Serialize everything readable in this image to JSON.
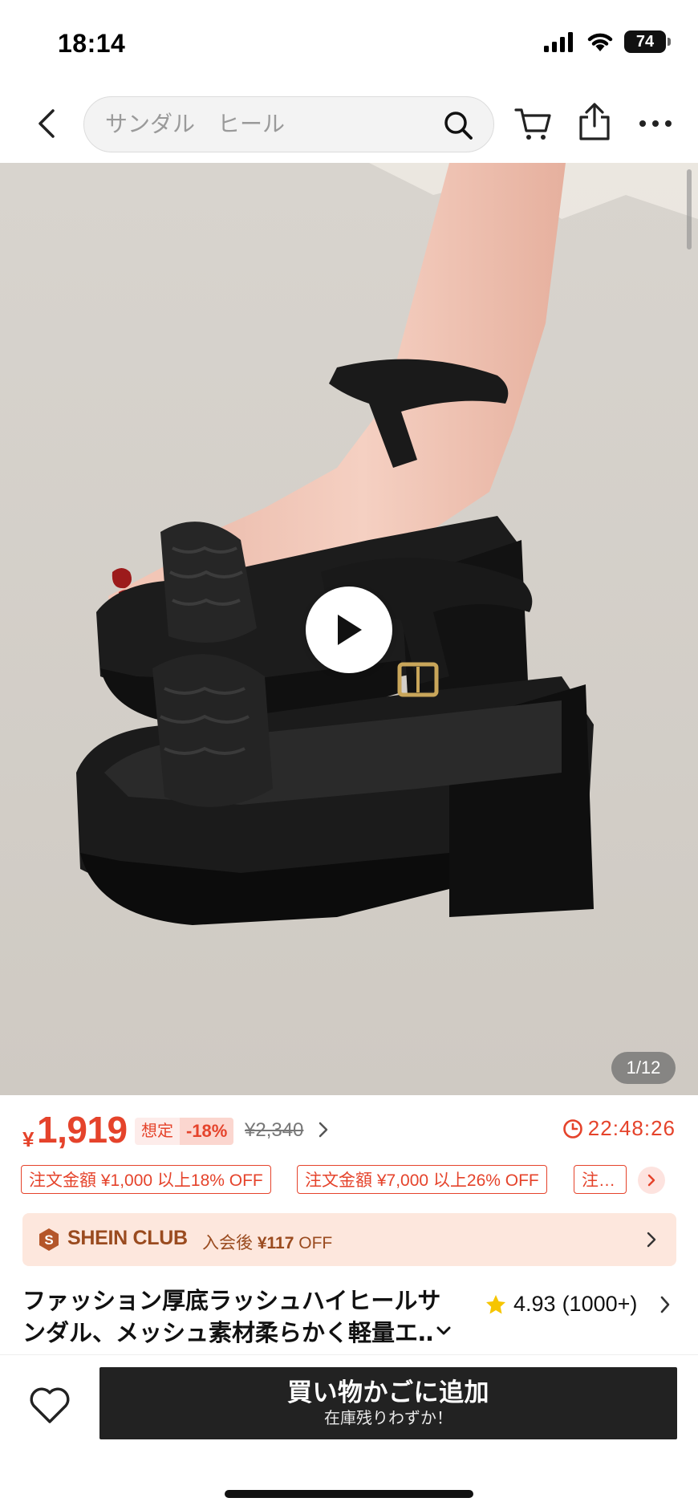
{
  "status_bar": {
    "time": "18:14",
    "battery": "74"
  },
  "header": {
    "search_placeholder": "サンダル　ヒール"
  },
  "gallery": {
    "counter": "1/12"
  },
  "price": {
    "currency": "¥",
    "current": "1,919",
    "estimated_label": "想定",
    "discount": "-18%",
    "original": "¥2,340",
    "countdown": "22:48:26"
  },
  "coupons": [
    {
      "label": "注文金額 ¥1,000 以上18% OFF"
    },
    {
      "label": "注文金額 ¥7,000 以上26% OFF"
    },
    {
      "label": "注…"
    }
  ],
  "club": {
    "name": "SHEIN CLUB",
    "offer_prefix": "入会後",
    "offer_amount": "¥117",
    "offer_suffix": "OFF"
  },
  "product": {
    "title": "ファッション厚底ラッシュハイヒールサンダル、メッシュ素材柔らかく軽量エ‥",
    "rating": "4.93",
    "review_count": "(1000+)"
  },
  "bottom_bar": {
    "add_to_cart_label": "買い物かごに追加",
    "stock_note": "在庫残りわずか！"
  },
  "colors": {
    "accent": "#e5432b",
    "club_bg": "#fde7dd",
    "club_text": "#9a4b1f",
    "button_bg": "#222222",
    "star": "#f6c500"
  }
}
